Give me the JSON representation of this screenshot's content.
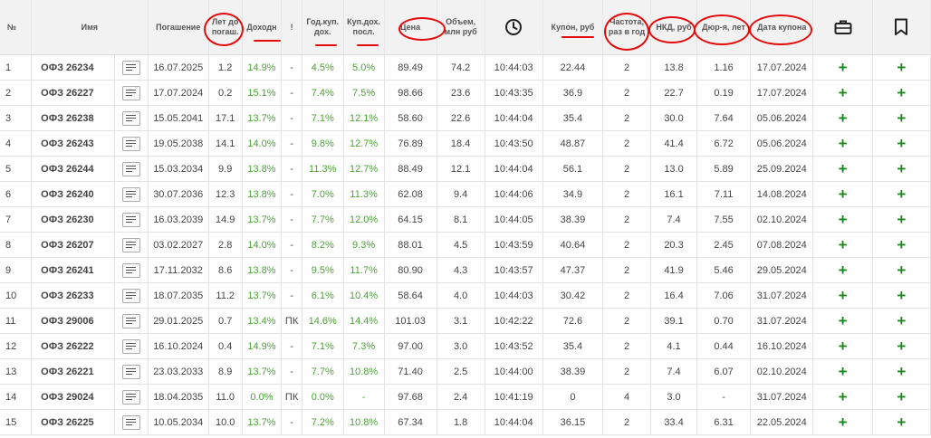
{
  "headers": [
    "№",
    "Имя",
    "Погашение",
    "Лет до погаш.",
    "Доходн",
    "!",
    "Год.куп. дох.",
    "Куп.дох. посл.",
    "Цена",
    "Объем, млн руб",
    "clock-icon",
    "Купон, руб",
    "Частота, раз в год",
    "НКД, руб",
    "Дюр-я, лет",
    "Дата купона",
    "briefcase-icon",
    "bookmark-icon"
  ],
  "header_labels": {
    "num": "№",
    "name": "Имя",
    "maturity": "Погашение",
    "years_line1": "Лет до",
    "years_line2": "погаш.",
    "yield": "Доходн",
    "warn": "!",
    "annual_line1": "Год.куп.",
    "annual_line2": "дох.",
    "last_line1": "Куп.дох.",
    "last_line2": "посл.",
    "price": "Цена",
    "volume_line1": "Объем,",
    "volume_line2": "млн руб",
    "coupon": "Купон, руб",
    "freq_line1": "Частота,",
    "freq_line2": "раз в год",
    "nkd": "НКД, руб",
    "duration": "Дюр-я, лет",
    "coupon_date": "Дата купона"
  },
  "icons": {
    "time": "clock-icon",
    "portfolio": "briefcase-icon",
    "favorites": "bookmark-icon",
    "row_action": "document-lines-icon",
    "add": "plus-icon"
  },
  "colors": {
    "green": "#4aa336",
    "plus": "#1e8a1e",
    "annotation": "#e30b0b",
    "header_bg": "#f2f2f2"
  },
  "plus_symbol": "+",
  "rows": [
    {
      "n": "1",
      "name": "ОФЗ 26234",
      "maturity": "16.07.2025",
      "years": "1.2",
      "yield": "14.9%",
      "warn": "-",
      "annual": "4.5%",
      "last": "5.0%",
      "price": "89.49",
      "volume": "74.2",
      "time": "10:44:03",
      "coupon": "22.44",
      "freq": "2",
      "nkd": "13.8",
      "duration": "1.16",
      "date": "17.07.2024"
    },
    {
      "n": "2",
      "name": "ОФЗ 26227",
      "maturity": "17.07.2024",
      "years": "0.2",
      "yield": "15.1%",
      "warn": "-",
      "annual": "7.4%",
      "last": "7.5%",
      "price": "98.66",
      "volume": "23.6",
      "time": "10:43:35",
      "coupon": "36.9",
      "freq": "2",
      "nkd": "22.7",
      "duration": "0.19",
      "date": "17.07.2024"
    },
    {
      "n": "3",
      "name": "ОФЗ 26238",
      "maturity": "15.05.2041",
      "years": "17.1",
      "yield": "13.7%",
      "warn": "-",
      "annual": "7.1%",
      "last": "12.1%",
      "price": "58.60",
      "volume": "22.6",
      "time": "10:44:04",
      "coupon": "35.4",
      "freq": "2",
      "nkd": "30.0",
      "duration": "7.64",
      "date": "05.06.2024"
    },
    {
      "n": "4",
      "name": "ОФЗ 26243",
      "maturity": "19.05.2038",
      "years": "14.1",
      "yield": "14.0%",
      "warn": "-",
      "annual": "9.8%",
      "last": "12.7%",
      "price": "76.89",
      "volume": "18.4",
      "time": "10:43:50",
      "coupon": "48.87",
      "freq": "2",
      "nkd": "41.4",
      "duration": "6.72",
      "date": "05.06.2024"
    },
    {
      "n": "5",
      "name": "ОФЗ 26244",
      "maturity": "15.03.2034",
      "years": "9.9",
      "yield": "13.8%",
      "warn": "-",
      "annual": "11.3%",
      "last": "12.7%",
      "price": "88.49",
      "volume": "12.1",
      "time": "10:44:04",
      "coupon": "56.1",
      "freq": "2",
      "nkd": "13.0",
      "duration": "5.89",
      "date": "25.09.2024"
    },
    {
      "n": "6",
      "name": "ОФЗ 26240",
      "maturity": "30.07.2036",
      "years": "12.3",
      "yield": "13.8%",
      "warn": "-",
      "annual": "7.0%",
      "last": "11.3%",
      "price": "62.08",
      "volume": "9.4",
      "time": "10:44:06",
      "coupon": "34.9",
      "freq": "2",
      "nkd": "16.1",
      "duration": "7.11",
      "date": "14.08.2024"
    },
    {
      "n": "7",
      "name": "ОФЗ 26230",
      "maturity": "16.03.2039",
      "years": "14.9",
      "yield": "13.7%",
      "warn": "-",
      "annual": "7.7%",
      "last": "12.0%",
      "price": "64.15",
      "volume": "8.1",
      "time": "10:44:05",
      "coupon": "38.39",
      "freq": "2",
      "nkd": "7.4",
      "duration": "7.55",
      "date": "02.10.2024"
    },
    {
      "n": "8",
      "name": "ОФЗ 26207",
      "maturity": "03.02.2027",
      "years": "2.8",
      "yield": "14.0%",
      "warn": "-",
      "annual": "8.2%",
      "last": "9.3%",
      "price": "88.01",
      "volume": "4.5",
      "time": "10:43:59",
      "coupon": "40.64",
      "freq": "2",
      "nkd": "20.3",
      "duration": "2.45",
      "date": "07.08.2024"
    },
    {
      "n": "9",
      "name": "ОФЗ 26241",
      "maturity": "17.11.2032",
      "years": "8.6",
      "yield": "13.8%",
      "warn": "-",
      "annual": "9.5%",
      "last": "11.7%",
      "price": "80.90",
      "volume": "4.3",
      "time": "10:43:57",
      "coupon": "47.37",
      "freq": "2",
      "nkd": "41.9",
      "duration": "5.46",
      "date": "29.05.2024"
    },
    {
      "n": "10",
      "name": "ОФЗ 26233",
      "maturity": "18.07.2035",
      "years": "11.2",
      "yield": "13.7%",
      "warn": "-",
      "annual": "6.1%",
      "last": "10.4%",
      "price": "58.64",
      "volume": "4.0",
      "time": "10:44:03",
      "coupon": "30.42",
      "freq": "2",
      "nkd": "16.4",
      "duration": "7.06",
      "date": "31.07.2024"
    },
    {
      "n": "11",
      "name": "ОФЗ 29006",
      "maturity": "29.01.2025",
      "years": "0.7",
      "yield": "13.4%",
      "warn": "ПК",
      "annual": "14.6%",
      "last": "14.4%",
      "price": "101.03",
      "volume": "3.1",
      "time": "10:42:22",
      "coupon": "72.6",
      "freq": "2",
      "nkd": "39.1",
      "duration": "0.70",
      "date": "31.07.2024"
    },
    {
      "n": "12",
      "name": "ОФЗ 26222",
      "maturity": "16.10.2024",
      "years": "0.4",
      "yield": "14.9%",
      "warn": "-",
      "annual": "7.1%",
      "last": "7.3%",
      "price": "97.00",
      "volume": "3.0",
      "time": "10:43:52",
      "coupon": "35.4",
      "freq": "2",
      "nkd": "4.1",
      "duration": "0.44",
      "date": "16.10.2024"
    },
    {
      "n": "13",
      "name": "ОФЗ 26221",
      "maturity": "23.03.2033",
      "years": "8.9",
      "yield": "13.7%",
      "warn": "-",
      "annual": "7.7%",
      "last": "10.8%",
      "price": "71.40",
      "volume": "2.5",
      "time": "10:44:00",
      "coupon": "38.39",
      "freq": "2",
      "nkd": "7.4",
      "duration": "6.07",
      "date": "02.10.2024"
    },
    {
      "n": "14",
      "name": "ОФЗ 29024",
      "maturity": "18.04.2035",
      "years": "11.0",
      "yield": "0.0%",
      "warn": "ПК",
      "annual": "0.0%",
      "last": "-",
      "price": "97.68",
      "volume": "2.4",
      "time": "10:41:19",
      "coupon": "0",
      "freq": "4",
      "nkd": "3.0",
      "duration": "-",
      "date": "31.07.2024"
    },
    {
      "n": "15",
      "name": "ОФЗ 26225",
      "maturity": "10.05.2034",
      "years": "10.0",
      "yield": "13.7%",
      "warn": "-",
      "annual": "7.2%",
      "last": "10.8%",
      "price": "67.34",
      "volume": "1.8",
      "time": "10:44:04",
      "coupon": "36.15",
      "freq": "2",
      "nkd": "33.4",
      "duration": "6.31",
      "date": "22.05.2024"
    }
  ]
}
